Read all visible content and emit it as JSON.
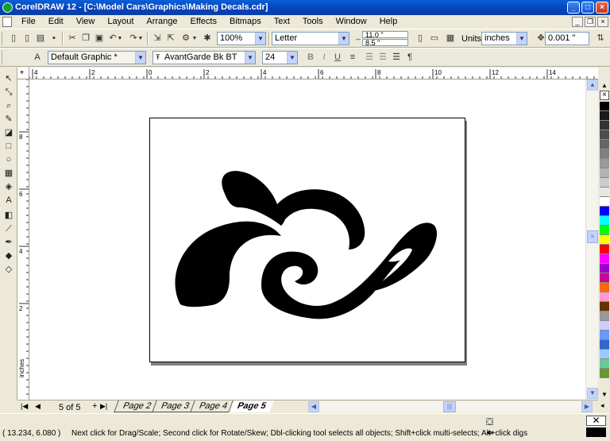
{
  "window": {
    "title": "CorelDRAW 12 - [C:\\Model Cars\\Graphics\\Making Decals.cdr]"
  },
  "menu": [
    "File",
    "Edit",
    "View",
    "Layout",
    "Arrange",
    "Effects",
    "Bitmaps",
    "Text",
    "Tools",
    "Window",
    "Help"
  ],
  "toolbar": {
    "zoom": "100%",
    "paper_size": "Letter",
    "page_width": "11.0 \"",
    "page_height": "8.5 \"",
    "units_label": "Units:",
    "units": "inches",
    "nudge": "0.001 \""
  },
  "property_bar": {
    "style": "Default Graphic *",
    "font_name": "AvantGarde Bk BT",
    "font_size": "24"
  },
  "ruler": {
    "units": "inches",
    "top_labels": [
      "4",
      "2",
      "0",
      "2",
      "4",
      "6",
      "8",
      "10",
      "12",
      "14"
    ],
    "left_labels": [
      "8",
      "6",
      "4",
      "2"
    ]
  },
  "page_nav": {
    "counter": "5 of 5",
    "tabs": [
      "Page 2",
      "Page 3",
      "Page 4",
      "Page 5"
    ],
    "active_tab": "Page 5"
  },
  "status": {
    "coords": "( 13.234, 6.080 )",
    "hint": "Next click for Drag/Scale; Second click for Rotate/Skew; Dbl-clicking tool selects all objects; Shift+click multi-selects; Alt+click digs"
  },
  "palette": [
    "#000000",
    "#1a1a1a",
    "#333333",
    "#4d4d4d",
    "#666666",
    "#808080",
    "#999999",
    "#b3b3b3",
    "#cccccc",
    "#e6e6e6",
    "#ffffff",
    "#0000ff",
    "#00ffff",
    "#00ff00",
    "#ffff00",
    "#ff0000",
    "#ff00ff",
    "#9900cc",
    "#cc0099",
    "#ff6600",
    "#ff99cc",
    "#663300",
    "#999999",
    "#ccccff",
    "#6699ff",
    "#3366cc",
    "#99ccff",
    "#66cc99",
    "#669933"
  ]
}
